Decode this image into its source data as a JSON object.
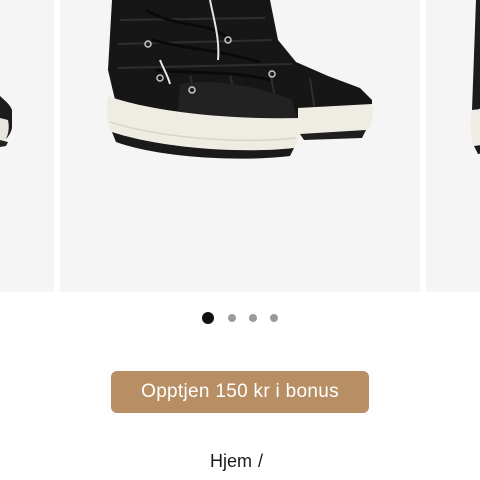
{
  "gallery": {
    "zoom_icon": "magnifier-icon",
    "slide_count": 4,
    "active_slide": 1
  },
  "bonus_button": {
    "label": "Opptjen 150 kr i bonus",
    "color": "#b88f64"
  },
  "breadcrumb": {
    "home_label": "Hjem",
    "separator": "/"
  }
}
